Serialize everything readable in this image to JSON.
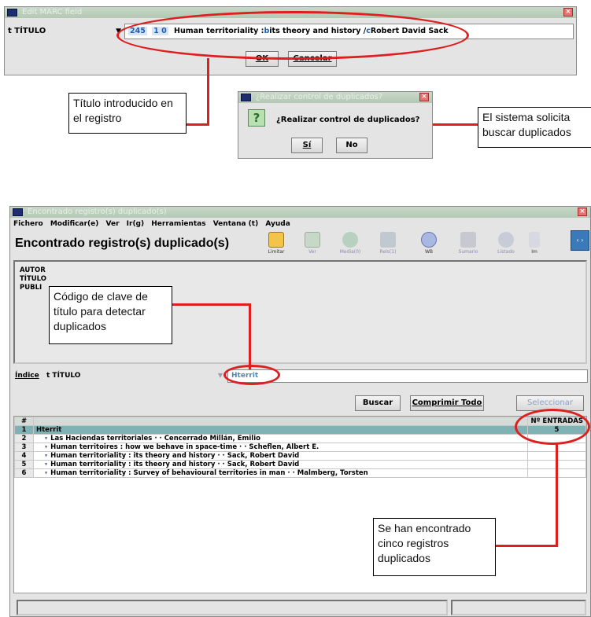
{
  "edit_marc": {
    "title": "Edit MARC field",
    "field_select": "t TÍTULO",
    "tag": "245",
    "ind": "1 0",
    "content_a": "Human territoriality :",
    "sub_b": "b",
    "content_b": "its theory and history /",
    "sub_c": "c",
    "content_c": "Robert David Sack",
    "ok_label": "OK",
    "cancel_label": "Cancelar"
  },
  "dup_dialog": {
    "title": "¿Realizar control de duplicados?",
    "question": "¿Realizar control de duplicados?",
    "icon_glyph": "?",
    "yes_label": "Sí",
    "no_label": "No"
  },
  "callouts": {
    "title_entered": "Título introducido en el registro",
    "system_requests": "El sistema solicita buscar duplicados",
    "key_code": "Código de clave de título para detectar duplicados",
    "five_found": "Se han encontrado cinco registros duplicados"
  },
  "dup_window": {
    "title": "Encontrado registro(s) duplicado(s)",
    "heading": "Encontrado registro(s) duplicado(s)",
    "menu": [
      "Fichero",
      "Modificar(e)",
      "Ver",
      "Ir(g)",
      "Herramientas",
      "Ventana (t)",
      "Ayuda"
    ],
    "toolbar": [
      "Limitar",
      "Ver",
      "Media(0)",
      "Rels(1)",
      "WB",
      "Sumario",
      "Listado",
      "Im"
    ],
    "info_labels": [
      "AUTOR",
      "TÍTULO",
      "PUBLI"
    ],
    "index_label": "Índice",
    "index_select": "t TÍTULO",
    "search_value": "Hterrit",
    "buscar_label": "Buscar",
    "comprimir_label": "Comprimir Todo",
    "seleccionar_label": "Seleccionar",
    "col_num": "#",
    "col_entries": "Nº ENTRADAS",
    "key_row": {
      "num": "1",
      "text": "Hterrit",
      "entries": "5"
    },
    "rows": [
      {
        "num": "2",
        "text": "Las Haciendas territoriales · · Cencerrado Millán, Emilio"
      },
      {
        "num": "3",
        "text": "Human territoires : how we behave in space-time · · Scheflen, Albert E."
      },
      {
        "num": "4",
        "text": "Human territoriality : its theory and history · · Sack, Robert David"
      },
      {
        "num": "5",
        "text": "Human territoriality : its theory and history · · Sack, Robert David"
      },
      {
        "num": "6",
        "text": "Human territoriality : Survey of behavioural territories in man · · Malmberg, Torsten"
      }
    ]
  },
  "colors": {
    "accent_red": "#dd1f1f",
    "window_bg": "#e4e4e4",
    "titlebar": "#b4c8b4",
    "key_row_bg": "#7fb2b5",
    "heading_row_bg": "#d4dcd8",
    "link_blue": "#1a5fb0"
  }
}
